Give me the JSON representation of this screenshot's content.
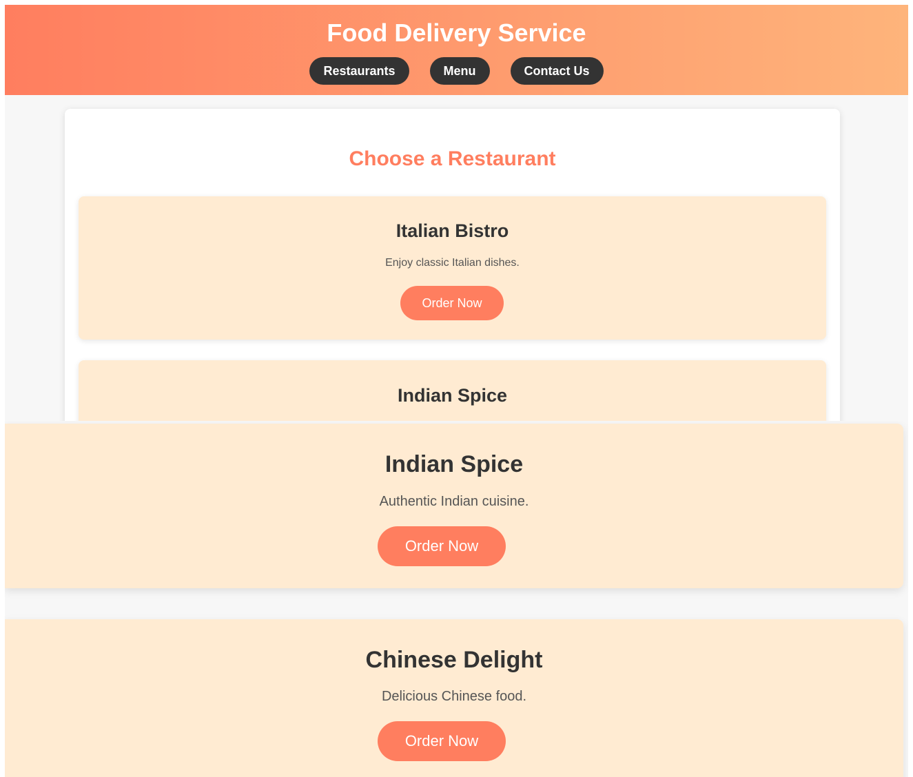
{
  "header": {
    "title": "Food Delivery Service",
    "nav": [
      "Restaurants",
      "Menu",
      "Contact Us"
    ]
  },
  "main": {
    "heading": "Choose a Restaurant",
    "restaurants": [
      {
        "name": "Italian Bistro",
        "description": "Enjoy classic Italian dishes.",
        "button": "Order Now"
      },
      {
        "name": "Indian Spice",
        "description": "Authentic Indian cuisine.",
        "button": "Order Now"
      },
      {
        "name": "Chinese Delight",
        "description": "Delicious Chinese food.",
        "button": "Order Now"
      }
    ]
  },
  "colors": {
    "header_gradient_start": "#ff7e5f",
    "header_gradient_end": "#feb47b",
    "accent": "#ff7e5f",
    "card_bg": "#ffebd2",
    "nav_button_bg": "#333333"
  }
}
